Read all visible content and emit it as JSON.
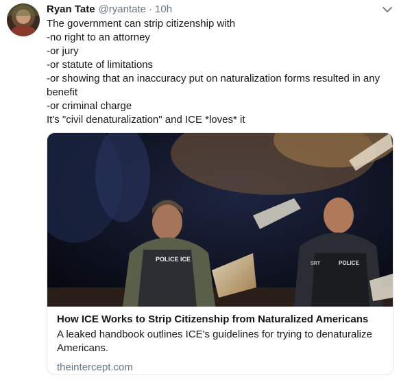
{
  "tweet": {
    "author_name": "Ryan Tate",
    "author_handle": "@ryantate",
    "separator": "·",
    "timestamp": "10h",
    "lines": [
      "The government can strip citizenship with",
      "-no right to an attorney",
      "-or jury",
      "-or statute of limitations",
      "-or showing that an inaccuracy put on naturalization forms resulted in any",
      "benefit",
      "-or criminal charge",
      "It's \"civil denaturalization\" and ICE *loves* it"
    ],
    "menu_icon": "chevron-down-icon"
  },
  "card": {
    "title": "How ICE Works to Strip Citizenship from Naturalized Americans",
    "description": "A leaked handbook outlines ICE's guidelines for trying to denaturalize Americans.",
    "domain": "theintercept.com",
    "image_badges": {
      "left_vest": "POLICE ICE",
      "right_vest": "POLICE",
      "right_patch": "SRT"
    }
  },
  "colors": {
    "text": "#14171a",
    "secondary": "#657786",
    "border": "#e1e8ed"
  }
}
